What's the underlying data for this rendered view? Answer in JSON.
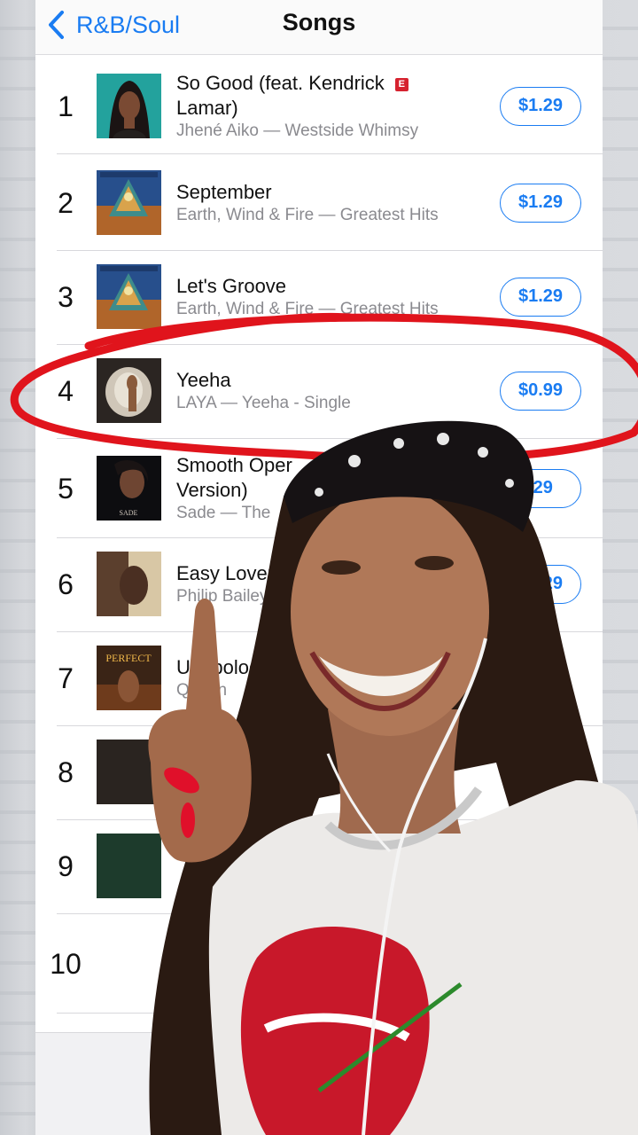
{
  "nav": {
    "back_label": "R&B/Soul",
    "title": "Songs"
  },
  "songs": [
    {
      "rank": "1",
      "title_line1": "So Good (feat. Kendrick",
      "title_line2": "Lamar)",
      "explicit": "E",
      "subtitle": "Jhené Aiko — Westside Whimsy",
      "price": "$1.29"
    },
    {
      "rank": "2",
      "title_line1": "September",
      "subtitle": "Earth, Wind & Fire — Greatest Hits",
      "price": "$1.29"
    },
    {
      "rank": "3",
      "title_line1": "Let's Groove",
      "subtitle": "Earth, Wind & Fire — Greatest Hits",
      "price": "$1.29"
    },
    {
      "rank": "4",
      "title_line1": "Yeeha",
      "subtitle": "LAYA — Yeeha - Single",
      "price": "$0.99"
    },
    {
      "rank": "5",
      "title_line1": "Smooth Oper",
      "title_line2": "Version)",
      "subtitle": "Sade — The",
      "price": ".29"
    },
    {
      "rank": "6",
      "title_line1": "Easy Lover",
      "subtitle": "Philip Bailey",
      "price": "$1.29"
    },
    {
      "rank": "7",
      "title_line1": "Unapolog",
      "subtitle": "Queen",
      "price": ""
    },
    {
      "rank": "8"
    },
    {
      "rank": "9"
    },
    {
      "rank": "10"
    }
  ],
  "colors": {
    "accent": "#1a7cf2",
    "explicit": "#d6222f",
    "circle": "#e0141c"
  },
  "icons": {
    "back": "chevron-left-icon"
  }
}
